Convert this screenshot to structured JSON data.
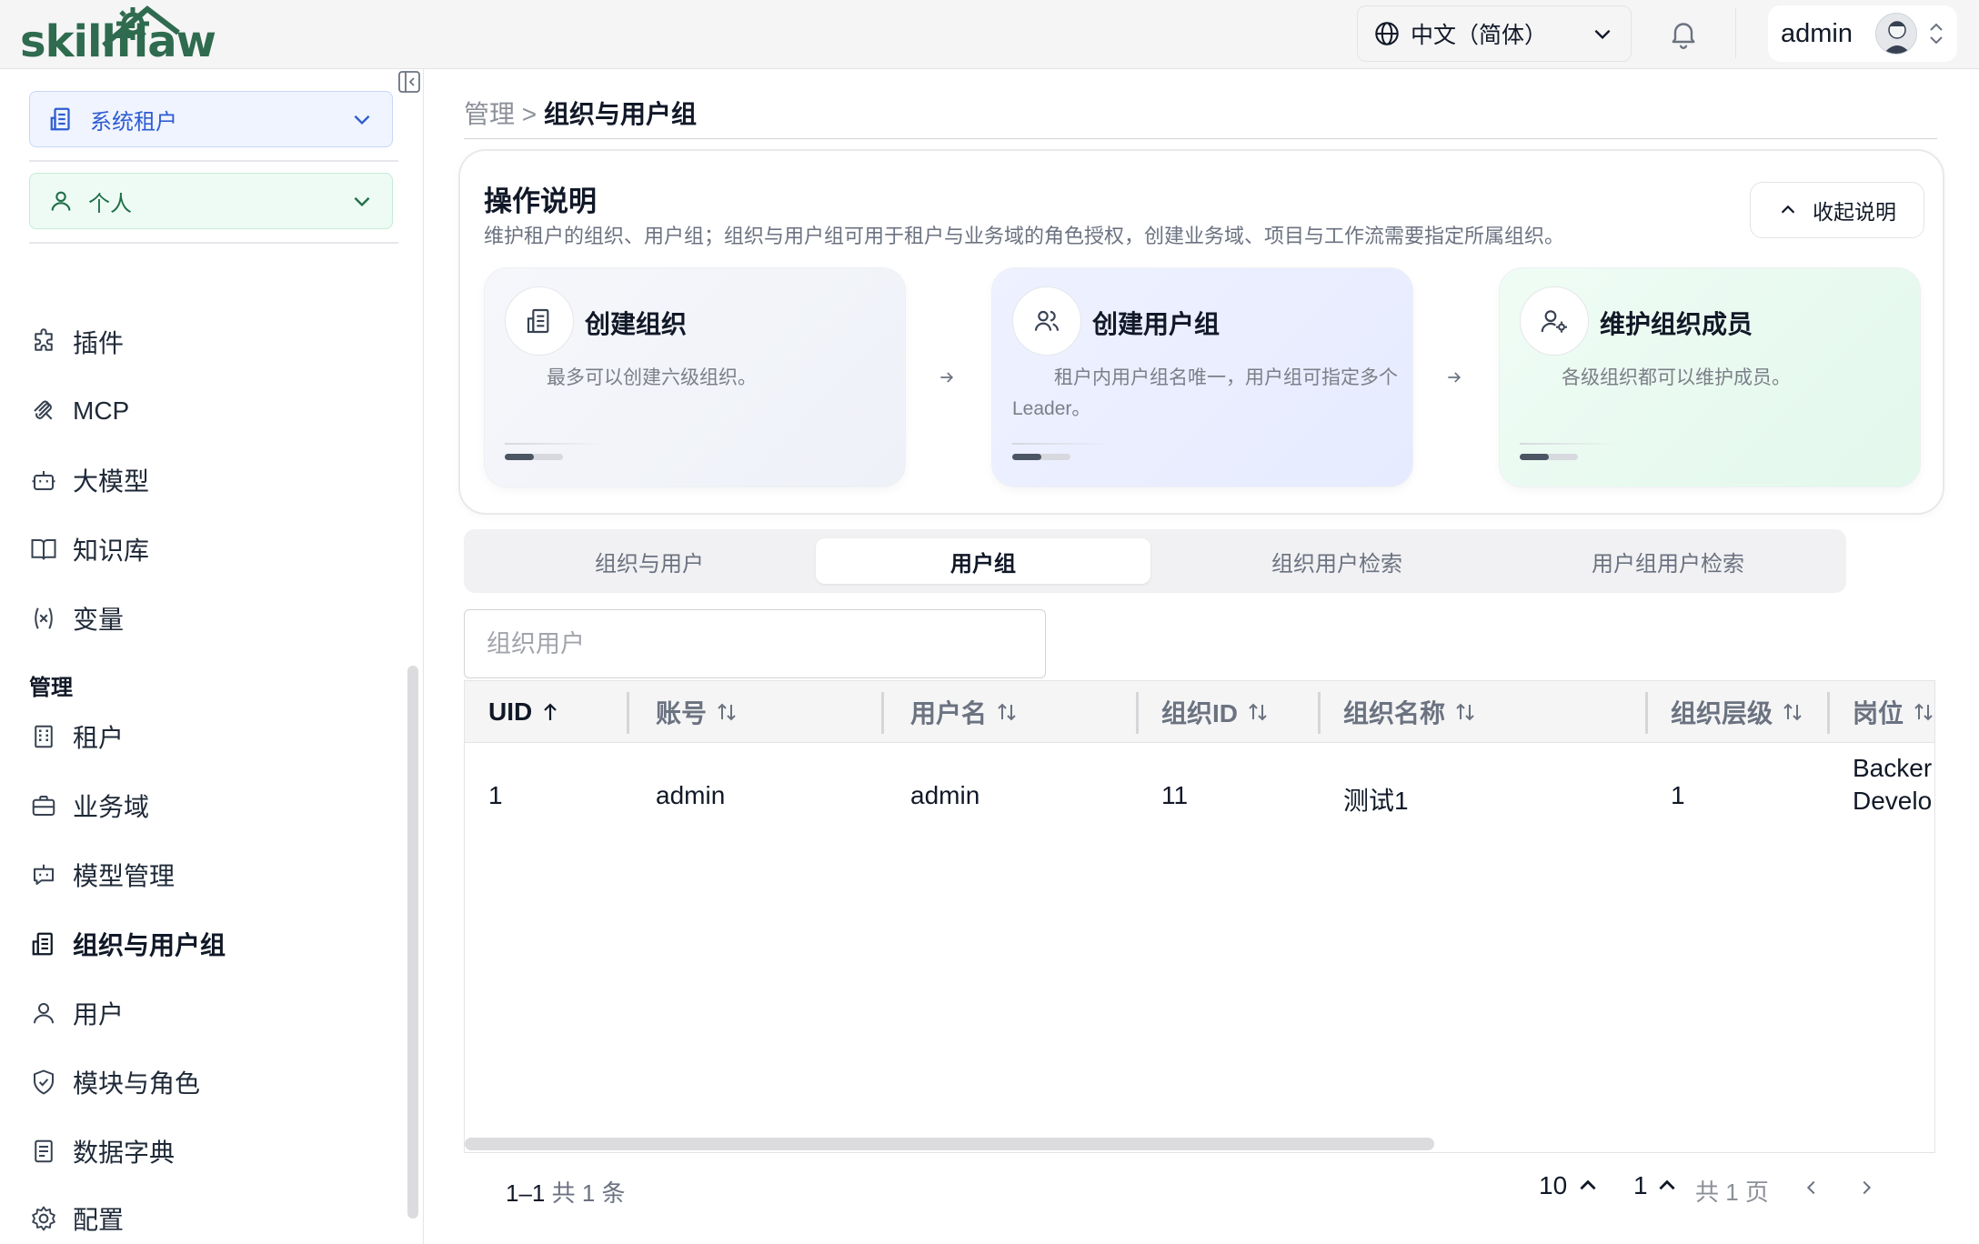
{
  "header": {
    "logo_text": "skillflaw",
    "language": "中文（简体）",
    "username": "admin"
  },
  "sidebar": {
    "tenant": "系统租户",
    "personal": "个人",
    "items": [
      {
        "label": "插件",
        "icon": "puzzle-icon"
      },
      {
        "label": "MCP",
        "icon": "mcp-icon"
      },
      {
        "label": "大模型",
        "icon": "bot-icon"
      },
      {
        "label": "知识库",
        "icon": "book-icon"
      },
      {
        "label": "变量",
        "icon": "variable-icon"
      }
    ],
    "section_label": "管理",
    "admin_items": [
      {
        "label": "租户",
        "icon": "building-icon"
      },
      {
        "label": "业务域",
        "icon": "briefcase-icon"
      },
      {
        "label": "模型管理",
        "icon": "bot-message-icon"
      },
      {
        "label": "组织与用户组",
        "icon": "org-icon",
        "active": true
      },
      {
        "label": "用户",
        "icon": "user-icon"
      },
      {
        "label": "模块与角色",
        "icon": "shield-icon"
      },
      {
        "label": "数据字典",
        "icon": "dictionary-icon"
      },
      {
        "label": "配置",
        "icon": "gear-icon"
      }
    ]
  },
  "breadcrumb": {
    "parent": "管理",
    "separator": ">",
    "current": "组织与用户组"
  },
  "help": {
    "title": "操作说明",
    "description": "维护租户的组织、用户组；组织与用户组可用于租户与业务域的角色授权，创建业务域、项目与工作流需要指定所属组织。",
    "collapse_label": "收起说明",
    "steps": [
      {
        "title": "创建组织",
        "desc": "最多可以创建六级组织。",
        "icon": "org-icon"
      },
      {
        "title": "创建用户组",
        "desc": "租户内用户组名唯一，用户组可指定多个 Leader。",
        "icon": "users-icon"
      },
      {
        "title": "维护组织成员",
        "desc": "各级组织都可以维护成员。",
        "icon": "user-gear-icon"
      }
    ]
  },
  "tabs": [
    "组织与用户",
    "用户组",
    "组织用户检索",
    "用户组用户检索"
  ],
  "active_tab": 1,
  "search": {
    "placeholder": "组织用户",
    "value": ""
  },
  "table": {
    "columns": [
      "UID",
      "账号",
      "用户名",
      "组织ID",
      "组织名称",
      "组织层级",
      "岗位"
    ],
    "rows": [
      {
        "uid": "1",
        "account": "admin",
        "username": "admin",
        "org_id": "11",
        "org_name": "测试1",
        "org_level": "1",
        "position_line1": "Backer",
        "position_line2": "Develo"
      }
    ]
  },
  "pagination": {
    "range": "1–1",
    "total_label": "共 1 条",
    "page_size": "10",
    "page": "1",
    "pages_label": "共 1 页"
  },
  "colors": {
    "brand_green": "#2f6b4f",
    "tenant_blue": "#2f5cd1",
    "personal_green": "#1f6f47"
  }
}
